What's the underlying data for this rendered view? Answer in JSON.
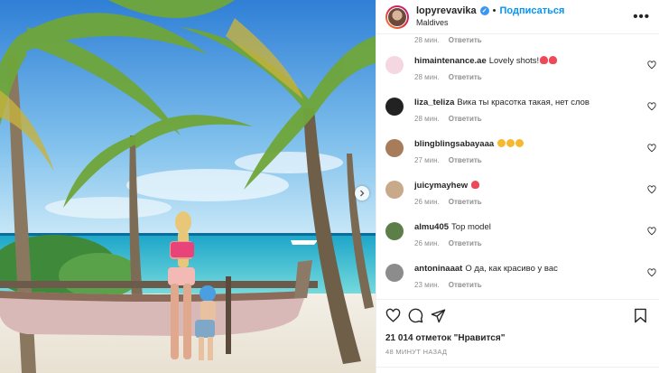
{
  "header": {
    "username": "lopyrevavika",
    "location": "Maldives",
    "separator": "•",
    "follow_label": "Подписаться",
    "more_label": "•••"
  },
  "first_comment_meta": {
    "time": "28 мин.",
    "reply": "Ответить"
  },
  "comments": [
    {
      "user": "himaintenance.ae",
      "text": "Lovely shots!",
      "emojis": [
        "red-heart",
        "red-heart"
      ],
      "time": "28 мин.",
      "reply": "Ответить"
    },
    {
      "user": "liza_teliza",
      "text": "Вика ты красотка такая, нет слов",
      "emojis": [],
      "time": "28 мин.",
      "reply": "Ответить"
    },
    {
      "user": "blingblingsabayaaa",
      "text": "",
      "emojis": [
        "heart-eyes",
        "heart-eyes",
        "heart-eyes"
      ],
      "time": "27 мин.",
      "reply": "Ответить"
    },
    {
      "user": "juicymayhew",
      "text": "",
      "emojis": [
        "red-heart"
      ],
      "time": "26 мин.",
      "reply": "Ответить"
    },
    {
      "user": "almu405",
      "text": "Top model",
      "emojis": [],
      "time": "26 мин.",
      "reply": "Ответить"
    },
    {
      "user": "antoninaaat",
      "text": "О да, как красиво у вас",
      "emojis": [],
      "time": "23 мин.",
      "reply": "Ответить"
    }
  ],
  "footer": {
    "likes": "21 014 отметок \"Нравится\"",
    "time_ago": "48 минут назад"
  },
  "colors": {
    "link": "#0095f6",
    "muted": "#8e8e8e",
    "heart": "#ed4956",
    "text": "#262626"
  }
}
